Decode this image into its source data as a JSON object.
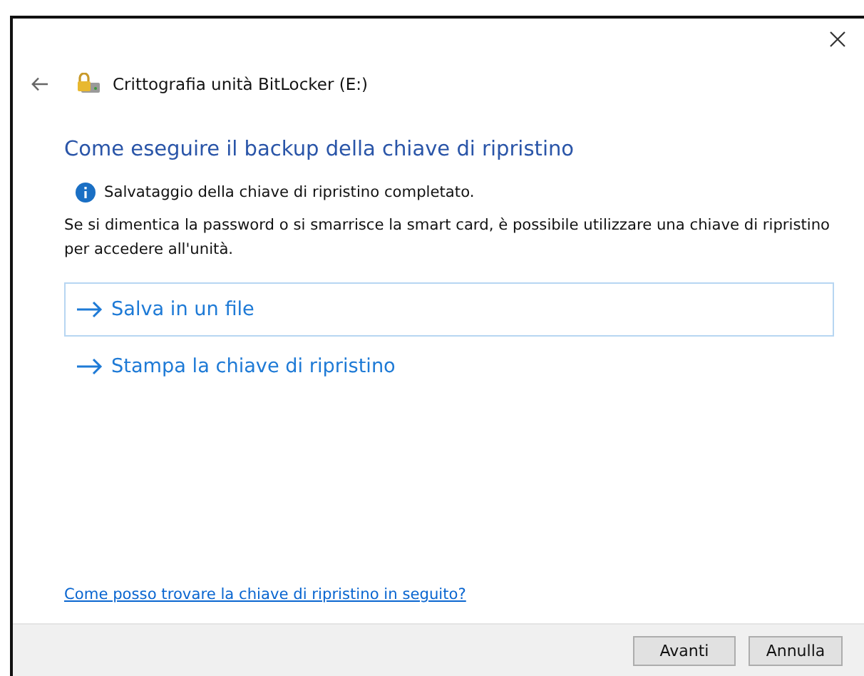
{
  "window": {
    "title": "Crittografia unità BitLocker (E:)"
  },
  "heading": "Come eseguire il backup della chiave di ripristino",
  "info": "Salvataggio della chiave di ripristino completato.",
  "description": "Se si dimentica la password o si smarrisce la smart card, è possibile utilizzare una chiave di ripristino per accedere all'unità.",
  "options": [
    {
      "label": "Salva in un file",
      "selected": true
    },
    {
      "label": "Stampa la chiave di ripristino",
      "selected": false
    }
  ],
  "help_link": "Come posso trovare la chiave di ripristino in seguito?",
  "buttons": [
    {
      "label": "Avanti",
      "kind": "primary"
    },
    {
      "label": "Annulla",
      "kind": "cancel"
    }
  ]
}
